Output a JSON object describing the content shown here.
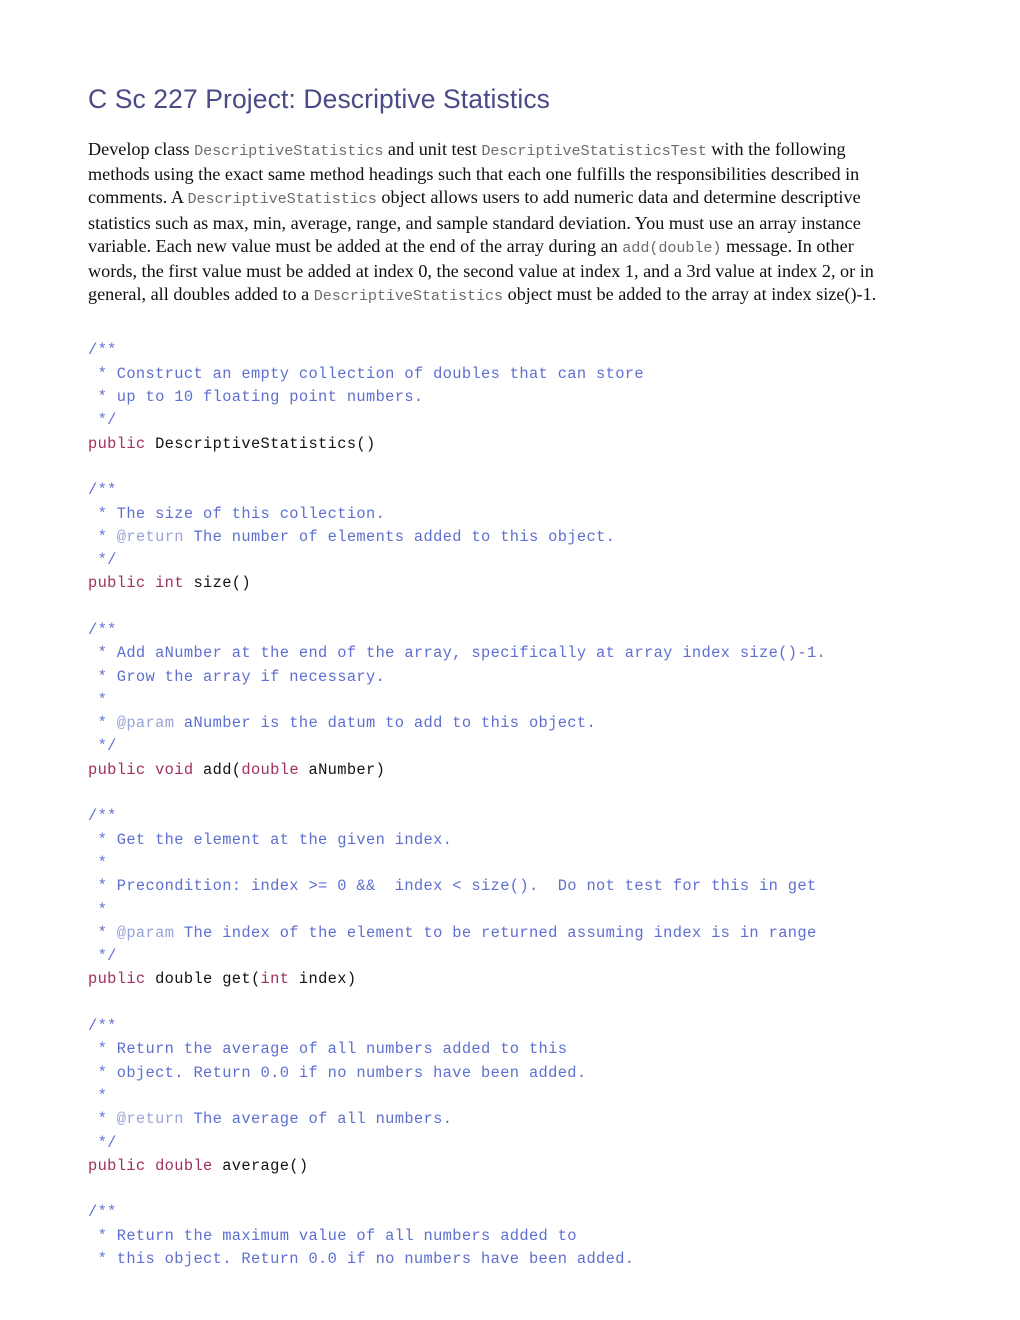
{
  "document": {
    "title": "C Sc 227 Project: Descriptive Statistics",
    "colors": {
      "title": "#4a4a86",
      "comment": "#5e6fd0",
      "javadoc_tag": "#9aa4d8",
      "keyword": "#9e3060",
      "identifier": "#121212",
      "inline_code": "#6d6d6d",
      "body_text": "#100f10",
      "page_background": "#ffffff"
    },
    "intro_paragraph": {
      "segments": [
        {
          "type": "text",
          "value": "Develop class "
        },
        {
          "type": "code",
          "value": "DescriptiveStatistics"
        },
        {
          "type": "text",
          "value": " and unit test "
        },
        {
          "type": "code",
          "value": "DescriptiveStatisticsTest"
        },
        {
          "type": "text",
          "value": " with the following methods using the exact same method headings such that each one fulfills the responsibilities described in comments. A "
        },
        {
          "type": "code",
          "value": "DescriptiveStatistics"
        },
        {
          "type": "text",
          "value": " object allows users to add numeric data and determine descriptive statistics such as max, min, average, range, and sample standard deviation. You must use an array instance variable. Each new value must be added at the end of the array during an "
        },
        {
          "type": "code",
          "value": "add(double)"
        },
        {
          "type": "text",
          "value": " message. In other words, the first value must be added at index 0, the second value at index 1, and a 3rd value at index 2, or in general, all doubles added to a "
        },
        {
          "type": "code",
          "value": "DescriptiveStatistics"
        },
        {
          "type": "text",
          "value": " object must be added to the array at index size()-1."
        }
      ]
    },
    "code_blocks": [
      {
        "name": "constructor",
        "lines": [
          [
            {
              "c": "cmt",
              "t": "/**"
            }
          ],
          [
            {
              "c": "cmt",
              "t": " * Construct an empty collection of doubles that can store"
            }
          ],
          [
            {
              "c": "cmt",
              "t": " * up to 10 floating point numbers."
            }
          ],
          [
            {
              "c": "cmt",
              "t": " */"
            }
          ],
          [
            {
              "c": "kw",
              "t": "public"
            },
            {
              "c": "id",
              "t": " DescriptiveStatistics()"
            }
          ]
        ]
      },
      {
        "name": "size-method",
        "lines": [
          [
            {
              "c": "cmt",
              "t": "/**"
            }
          ],
          [
            {
              "c": "cmt",
              "t": " * The size of this collection."
            }
          ],
          [
            {
              "c": "cmt",
              "t": " * "
            },
            {
              "c": "tag",
              "t": "@return"
            },
            {
              "c": "cmt",
              "t": " The number of elements added to this object."
            }
          ],
          [
            {
              "c": "cmt",
              "t": " */"
            }
          ],
          [
            {
              "c": "kw",
              "t": "public int"
            },
            {
              "c": "id",
              "t": " size()"
            }
          ]
        ]
      },
      {
        "name": "add-method",
        "lines": [
          [
            {
              "c": "cmt",
              "t": "/**"
            }
          ],
          [
            {
              "c": "cmt",
              "t": " * Add aNumber at the end of the array, specifically at array index size()-1."
            }
          ],
          [
            {
              "c": "cmt",
              "t": " * Grow the array if necessary."
            }
          ],
          [
            {
              "c": "cmt",
              "t": " *"
            }
          ],
          [
            {
              "c": "cmt",
              "t": " * "
            },
            {
              "c": "tag",
              "t": "@param"
            },
            {
              "c": "cmt",
              "t": " aNumber is the datum to add to this object."
            }
          ],
          [
            {
              "c": "cmt",
              "t": " */"
            }
          ],
          [
            {
              "c": "kw",
              "t": "public void"
            },
            {
              "c": "id",
              "t": " add("
            },
            {
              "c": "kw",
              "t": "double"
            },
            {
              "c": "id",
              "t": " aNumber)"
            }
          ]
        ]
      },
      {
        "name": "get-method",
        "lines": [
          [
            {
              "c": "cmt",
              "t": "/**"
            }
          ],
          [
            {
              "c": "cmt",
              "t": " * Get the element at the given index."
            }
          ],
          [
            {
              "c": "cmt",
              "t": " *"
            }
          ],
          [
            {
              "c": "cmt",
              "t": " * Precondition: index >= 0 &&  index < size().  Do not test for this in get"
            }
          ],
          [
            {
              "c": "cmt",
              "t": " *"
            }
          ],
          [
            {
              "c": "cmt",
              "t": " * "
            },
            {
              "c": "tag",
              "t": "@param"
            },
            {
              "c": "cmt",
              "t": " The index of the element to be returned assuming index is in range"
            }
          ],
          [
            {
              "c": "cmt",
              "t": " */"
            }
          ],
          [
            {
              "c": "kw",
              "t": "public"
            },
            {
              "c": "id",
              "t": " double get("
            },
            {
              "c": "kw",
              "t": "int"
            },
            {
              "c": "id",
              "t": " index)"
            }
          ]
        ]
      },
      {
        "name": "average-method",
        "lines": [
          [
            {
              "c": "cmt",
              "t": "/**"
            }
          ],
          [
            {
              "c": "cmt",
              "t": " * Return the average of all numbers added to this"
            }
          ],
          [
            {
              "c": "cmt",
              "t": " * object. Return 0.0 if no numbers have been added."
            }
          ],
          [
            {
              "c": "cmt",
              "t": " *"
            }
          ],
          [
            {
              "c": "cmt",
              "t": " * "
            },
            {
              "c": "tag",
              "t": "@return"
            },
            {
              "c": "cmt",
              "t": " The average of all numbers."
            }
          ],
          [
            {
              "c": "cmt",
              "t": " */"
            }
          ],
          [
            {
              "c": "kw",
              "t": "public double"
            },
            {
              "c": "id",
              "t": " average()"
            }
          ]
        ]
      },
      {
        "name": "max-method-partial",
        "lines": [
          [
            {
              "c": "cmt",
              "t": "/**"
            }
          ],
          [
            {
              "c": "cmt",
              "t": " * Return the maximum value of all numbers added to"
            }
          ],
          [
            {
              "c": "cmt",
              "t": " * this object. Return 0.0 if no numbers have been added."
            }
          ]
        ]
      }
    ]
  }
}
